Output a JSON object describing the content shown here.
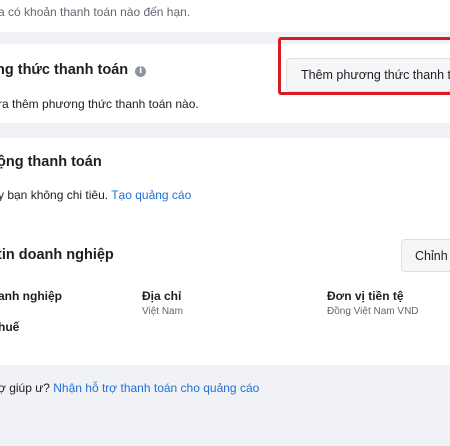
{
  "top": {
    "note": "a có khoản thanh toán nào đến hạn."
  },
  "payment_methods": {
    "title": "ng thức thanh toán",
    "info_icon": "info-icon",
    "description": "ra thêm phương thức thanh toán nào.",
    "add_button_label": "Thêm phương thức thanh toán"
  },
  "activity": {
    "title": "ộng thanh toán",
    "description_prefix": "y bạn không chi tiêu. ",
    "create_ad_link": "Tạo quảng cáo"
  },
  "business_info": {
    "title": "tin doanh nghiệp",
    "edit_button_label": "Chỉnh sửa",
    "business_label": "anh nghiệp",
    "tax_label": "huế",
    "address_label": "Địa chỉ",
    "address_value": "Việt Nam",
    "currency_label": "Đơn vị tiền tệ",
    "currency_value": "Đồng Việt Nam VND"
  },
  "help": {
    "prefix": "ợ giúp ư? ",
    "link": "Nhận hỗ trợ thanh toán cho quảng cáo"
  },
  "colors": {
    "highlight": "#d91c24",
    "link": "#216fdb",
    "background": "#f0f2f5"
  }
}
